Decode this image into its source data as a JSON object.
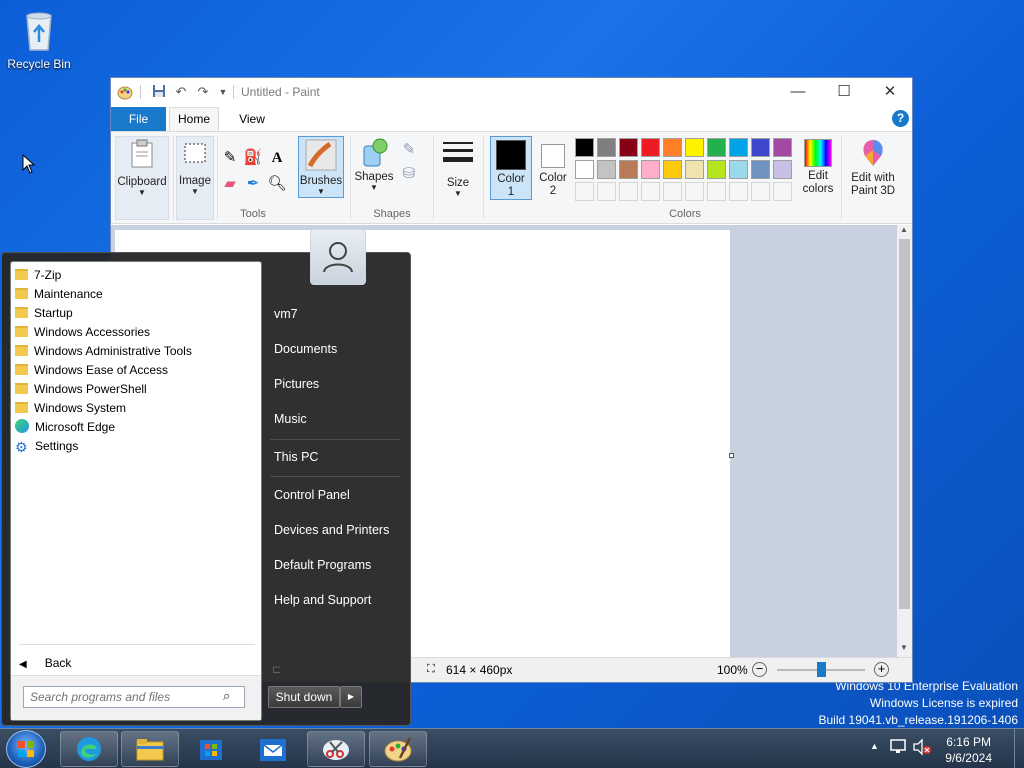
{
  "desktop": {
    "recycle_bin_label": "Recycle Bin",
    "watermark": {
      "line1": "Windows 10 Enterprise Evaluation",
      "line2": "Windows License is expired",
      "line3": "Build 19041.vb_release.191206-1406"
    }
  },
  "paint": {
    "title": "Untitled - Paint",
    "tabs": {
      "file": "File",
      "home": "Home",
      "view": "View"
    },
    "groups": {
      "clipboard": "Clipboard",
      "image": "Image",
      "tools": "Tools",
      "brushes": "Brushes",
      "shapes_btn": "Shapes",
      "shapes": "Shapes",
      "size": "Size",
      "color1": "Color\n1",
      "color2": "Color\n2",
      "colors": "Colors",
      "edit_colors": "Edit\ncolors",
      "paint3d": "Edit with\nPaint 3D"
    },
    "palette_row1": [
      "#000000",
      "#7f7f7f",
      "#880015",
      "#ed1c24",
      "#ff7f27",
      "#fff200",
      "#22b14c",
      "#00a2e8",
      "#3f48cc",
      "#a349a4"
    ],
    "palette_row2": [
      "#ffffff",
      "#c3c3c3",
      "#b97a57",
      "#ffaec9",
      "#ffc90e",
      "#efe4b0",
      "#b5e61d",
      "#99d9ea",
      "#7092be",
      "#c8bfe7"
    ],
    "color1_value": "#000000",
    "color2_value": "#ffffff",
    "status": {
      "canvas_size": "614 × 460px",
      "zoom": "100%",
      "zoom_fraction": 0.5
    }
  },
  "start_menu": {
    "programs": [
      {
        "label": "7-Zip",
        "icon": "folder-icon"
      },
      {
        "label": "Maintenance",
        "icon": "folder-icon"
      },
      {
        "label": "Startup",
        "icon": "folder-icon"
      },
      {
        "label": "Windows Accessories",
        "icon": "folder-icon"
      },
      {
        "label": "Windows Administrative Tools",
        "icon": "folder-icon"
      },
      {
        "label": "Windows Ease of Access",
        "icon": "folder-icon"
      },
      {
        "label": "Windows PowerShell",
        "icon": "folder-icon"
      },
      {
        "label": "Windows System",
        "icon": "folder-icon"
      },
      {
        "label": "Microsoft Edge",
        "icon": "edge-icon"
      },
      {
        "label": "Settings",
        "icon": "gear-icon"
      }
    ],
    "back_label": "Back",
    "search_placeholder": "Search programs and files",
    "right": {
      "user": "vm7",
      "documents": "Documents",
      "pictures": "Pictures",
      "music": "Music",
      "this_pc": "This PC",
      "control_panel": "Control Panel",
      "devices": "Devices and Printers",
      "default_programs": "Default Programs",
      "help": "Help and Support"
    },
    "shutdown_label": "Shut down"
  },
  "taskbar": {
    "time": "6:16 PM",
    "date": "9/6/2024"
  }
}
